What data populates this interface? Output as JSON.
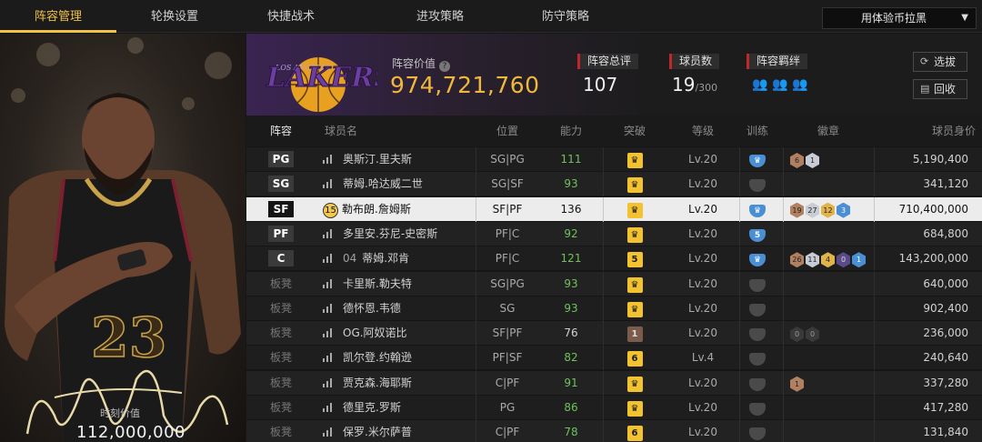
{
  "nav": {
    "tabs": [
      {
        "label": "阵容管理",
        "active": true
      },
      {
        "label": "轮换设置",
        "active": false
      },
      {
        "label": "快捷战术",
        "active": false
      },
      {
        "label": "进攻策略",
        "active": false
      },
      {
        "label": "防守策略",
        "active": false
      }
    ],
    "dropdown_value": "用体验币拉黑"
  },
  "hero": {
    "jersey_number": "23",
    "value_label": "时刻价值",
    "value": "112,000,000"
  },
  "team": {
    "logo_text": "LAKERS",
    "logo_subtext": "LOS ANGELES",
    "value_label": "阵容价值",
    "value": "974,721,760",
    "rating_label": "阵容总评",
    "rating": "107",
    "players_label": "球员数",
    "players_count": "19",
    "players_max": "/300",
    "bonds_label": "阵容羁绊",
    "buttons": {
      "draft": "选拔",
      "recycle": "回收"
    }
  },
  "table": {
    "headers": [
      "阵容",
      "球员名",
      "位置",
      "能力",
      "突破",
      "等级",
      "训练",
      "徽章",
      "球员身价"
    ],
    "rows": [
      {
        "slot": "PG",
        "bench": false,
        "name": "奥斯汀.里夫斯",
        "position": "SG|PG",
        "ability": "111",
        "breakthrough": "",
        "level": "Lv.20",
        "training": "on",
        "training_level": "",
        "badges": [
          {
            "t": "6",
            "c": "bronze"
          },
          {
            "t": "1",
            "c": "silver"
          }
        ],
        "value": "5,190,400",
        "selected": false
      },
      {
        "slot": "SG",
        "bench": false,
        "name": "蒂姆.哈达威二世",
        "position": "SG|SF",
        "ability": "93",
        "breakthrough": "",
        "level": "Lv.20",
        "training": "off",
        "training_level": "",
        "badges": [],
        "value": "341,120",
        "selected": false
      },
      {
        "slot": "SF",
        "bench": false,
        "tag": "15",
        "name": "勒布朗.詹姆斯",
        "position": "SF|PF",
        "ability": "136",
        "breakthrough": "",
        "level": "Lv.20",
        "training": "on",
        "training_level": "",
        "badges": [
          {
            "t": "19",
            "c": "bronze"
          },
          {
            "t": "27",
            "c": "silver"
          },
          {
            "t": "12",
            "c": "gold"
          },
          {
            "t": "3",
            "c": "blue"
          }
        ],
        "value": "710,400,000",
        "selected": true
      },
      {
        "slot": "PF",
        "bench": false,
        "name": "多里安.芬尼-史密斯",
        "position": "PF|C",
        "ability": "92",
        "breakthrough": "",
        "level": "Lv.20",
        "training": "on",
        "training_level": "5",
        "badges": [],
        "value": "684,800",
        "selected": false
      },
      {
        "slot": "C",
        "bench": false,
        "prefix": "04",
        "name": "蒂姆.邓肯",
        "position": "PF|C",
        "ability": "121",
        "breakthrough": "5",
        "level": "Lv.20",
        "training": "on",
        "training_level": "",
        "badges": [
          {
            "t": "26",
            "c": "bronze"
          },
          {
            "t": "11",
            "c": "silver"
          },
          {
            "t": "4",
            "c": "gold"
          },
          {
            "t": "0",
            "c": "purple"
          },
          {
            "t": "1",
            "c": "blue"
          }
        ],
        "value": "143,200,000",
        "selected": false
      },
      {
        "slot": "板凳",
        "bench": true,
        "name": "卡里斯.勒夫特",
        "position": "SG|PG",
        "ability": "93",
        "breakthrough": "",
        "level": "Lv.20",
        "training": "off",
        "training_level": "",
        "badges": [],
        "value": "640,000",
        "selected": false
      },
      {
        "slot": "板凳",
        "bench": true,
        "name": "德怀恩.韦德",
        "position": "SG",
        "ability": "93",
        "breakthrough": "",
        "level": "Lv.20",
        "training": "off",
        "training_level": "",
        "badges": [],
        "value": "902,400",
        "selected": false
      },
      {
        "slot": "板凳",
        "bench": true,
        "name": "OG.阿奴诺比",
        "position": "SF|PF",
        "ability": "76",
        "breakthrough": "1",
        "level": "Lv.20",
        "training": "off",
        "training_level": "",
        "badges": [
          {
            "t": "0",
            "c": "dark"
          },
          {
            "t": "0",
            "c": "dark"
          }
        ],
        "value": "236,000",
        "selected": false
      },
      {
        "slot": "板凳",
        "bench": true,
        "name": "凯尔登.约翰逊",
        "position": "PF|SF",
        "ability": "82",
        "breakthrough": "6",
        "level": "Lv.4",
        "training": "off",
        "training_level": "",
        "badges": [],
        "value": "240,640",
        "selected": false
      },
      {
        "slot": "板凳",
        "bench": true,
        "name": "贾克森.海耶斯",
        "position": "C|PF",
        "ability": "91",
        "breakthrough": "",
        "level": "Lv.20",
        "training": "off",
        "training_level": "",
        "badges": [
          {
            "t": "1",
            "c": "bronze"
          }
        ],
        "value": "337,280",
        "selected": false
      },
      {
        "slot": "板凳",
        "bench": true,
        "name": "德里克.罗斯",
        "position": "PG",
        "ability": "86",
        "breakthrough": "",
        "level": "Lv.20",
        "training": "off",
        "training_level": "",
        "badges": [],
        "value": "417,280",
        "selected": false
      },
      {
        "slot": "板凳",
        "bench": true,
        "name": "保罗.米尔萨普",
        "position": "C|PF",
        "ability": "78",
        "breakthrough": "6",
        "level": "Lv.20",
        "training": "off",
        "training_level": "",
        "badges": [],
        "value": "131,840",
        "selected": false
      }
    ]
  },
  "colors": {
    "accent": "#f0c24a",
    "value_gold": "#f0b73c",
    "ability_green": "#6fc25b",
    "lakers_purple": "#552583",
    "training_blue": "#4a8fd4"
  }
}
